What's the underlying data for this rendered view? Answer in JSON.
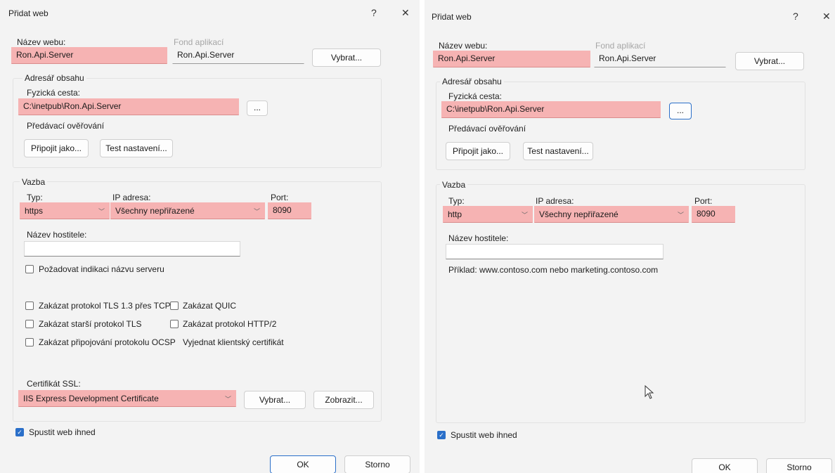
{
  "left": {
    "title": "Přidat web",
    "help": "?",
    "close": "✕",
    "site_name_label": "Název webu:",
    "site_name_value": "Ron.Api.Server",
    "app_pool_label": "Fond aplikací",
    "app_pool_value": "Ron.Api.Server",
    "select_pool_btn": "Vybrat...",
    "content_dir_label": "Adresář obsahu",
    "physical_path_label": "Fyzická cesta:",
    "physical_path_value": "C:\\inetpub\\Ron.Api.Server",
    "browse_btn": "...",
    "pass_auth_label": "Předávací ověřování",
    "connect_as_btn": "Připojit jako...",
    "test_settings_btn": "Test nastavení...",
    "binding_label": "Vazba",
    "type_label": "Typ:",
    "type_value": "https",
    "ip_label": "IP adresa:",
    "ip_value": "Všechny nepřiřazené",
    "port_label": "Port:",
    "port_value": "8090",
    "hostname_label": "Název hostitele:",
    "hostname_value": "",
    "sni_label": "Požadovat indikaci názvu serveru",
    "tls13_label": "Zakázat protokol TLS 1.3 přes TCP",
    "quic_label": "Zakázat QUIC",
    "legacy_tls_label": "Zakázat starší protokol TLS",
    "http2_label": "Zakázat protokol HTTP/2",
    "ocsp_label": "Zakázat připojování protokolu OCSP",
    "negotiate_cert_label": "Vyjednat klientský certifikát",
    "ssl_cert_label": "Certifikát SSL:",
    "ssl_cert_value": "IIS Express Development Certificate",
    "select_cert_btn": "Vybrat...",
    "view_cert_btn": "Zobrazit...",
    "start_label": "Spustit web ihned",
    "ok_btn": "OK",
    "cancel_btn": "Storno"
  },
  "right": {
    "title": "Přidat web",
    "help": "?",
    "close": "✕",
    "site_name_label": "Název webu:",
    "site_name_value": "Ron.Api.Server",
    "app_pool_label": "Fond aplikací",
    "app_pool_value": "Ron.Api.Server",
    "select_pool_btn": "Vybrat...",
    "content_dir_label": "Adresář obsahu",
    "physical_path_label": "Fyzická cesta:",
    "physical_path_value": "C:\\inetpub\\Ron.Api.Server",
    "browse_btn": "...",
    "pass_auth_label": "Předávací ověřování",
    "connect_as_btn": "Připojit jako...",
    "test_settings_btn": "Test nastavení...",
    "binding_label": "Vazba",
    "type_label": "Typ:",
    "type_value": "http",
    "ip_label": "IP adresa:",
    "ip_value": "Všechny nepřiřazené",
    "port_label": "Port:",
    "port_value": "8090",
    "hostname_label": "Název hostitele:",
    "hostname_value": "",
    "example_label": "Příklad: www.contoso.com nebo marketing.contoso.com",
    "start_label": "Spustit web ihned",
    "ok_btn": "OK",
    "cancel_btn": "Storno"
  },
  "colors": {
    "highlight": "#f6b3b3",
    "dialog_bg": "#f3f3f3",
    "accent": "#2a6fc9"
  }
}
